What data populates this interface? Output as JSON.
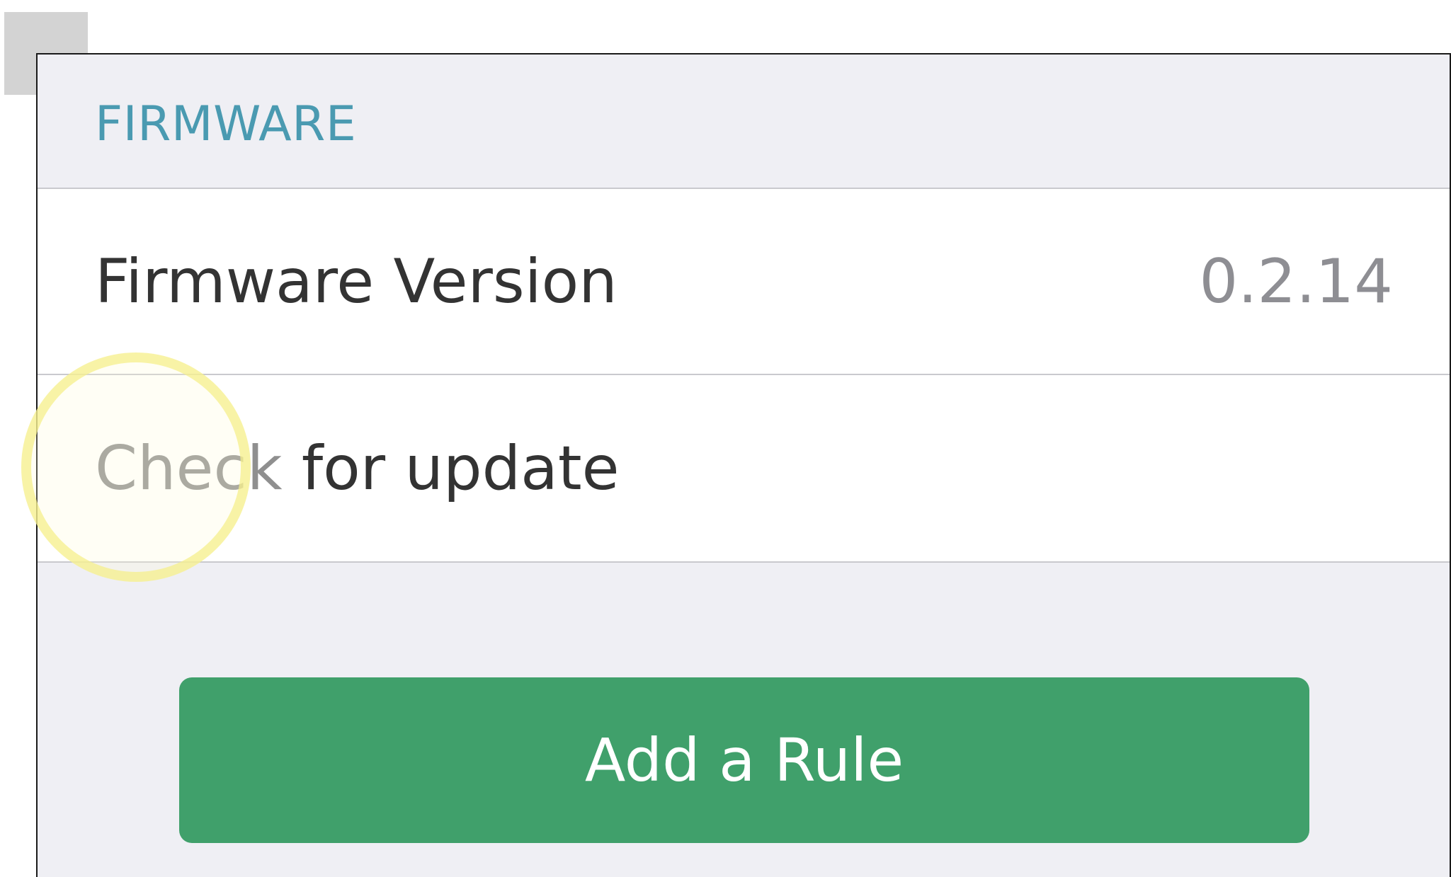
{
  "section": {
    "title": "FIRMWARE"
  },
  "firmware_version": {
    "label": "Firmware Version",
    "value": "0.2.14"
  },
  "check_update": {
    "label_part1": "Check",
    "label_part2": " for update"
  },
  "actions": {
    "add_rule_label": "Add a Rule"
  },
  "colors": {
    "section_header": "#4a9ab1",
    "background": "#efeff4",
    "button": "#40a06b",
    "tap_indicator": "#f6f08c"
  }
}
